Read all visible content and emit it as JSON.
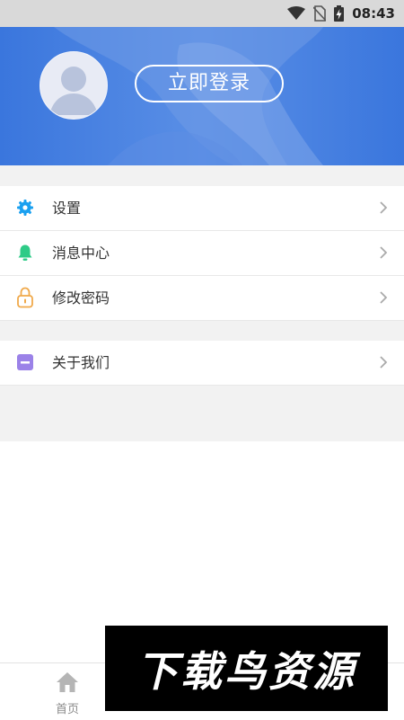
{
  "status_bar": {
    "time": "08:43",
    "icons": [
      "wifi-icon",
      "no-sim-icon",
      "battery-charging-icon"
    ]
  },
  "header": {
    "login_label": "立即登录",
    "background_color": "#3f7ce2",
    "avatar_icon": "user-avatar-icon"
  },
  "menu": {
    "items": [
      {
        "label": "设置",
        "icon": "gear-icon",
        "icon_color": "#1aa0f0"
      },
      {
        "label": "消息中心",
        "icon": "bell-icon",
        "icon_color": "#2ecb87"
      },
      {
        "label": "修改密码",
        "icon": "lock-icon",
        "icon_color": "#f0a94a"
      }
    ],
    "items2": [
      {
        "label": "关于我们",
        "icon": "info-card-icon",
        "icon_color": "#9b82e8"
      }
    ]
  },
  "tabbar": {
    "tabs": [
      {
        "label": "首页",
        "icon": "home-icon",
        "active": false
      },
      {
        "label": "",
        "active": false
      },
      {
        "label": "",
        "active": true
      }
    ],
    "active_color": "#3f7ce2"
  },
  "watermark": {
    "text": "下载鸟资源"
  }
}
